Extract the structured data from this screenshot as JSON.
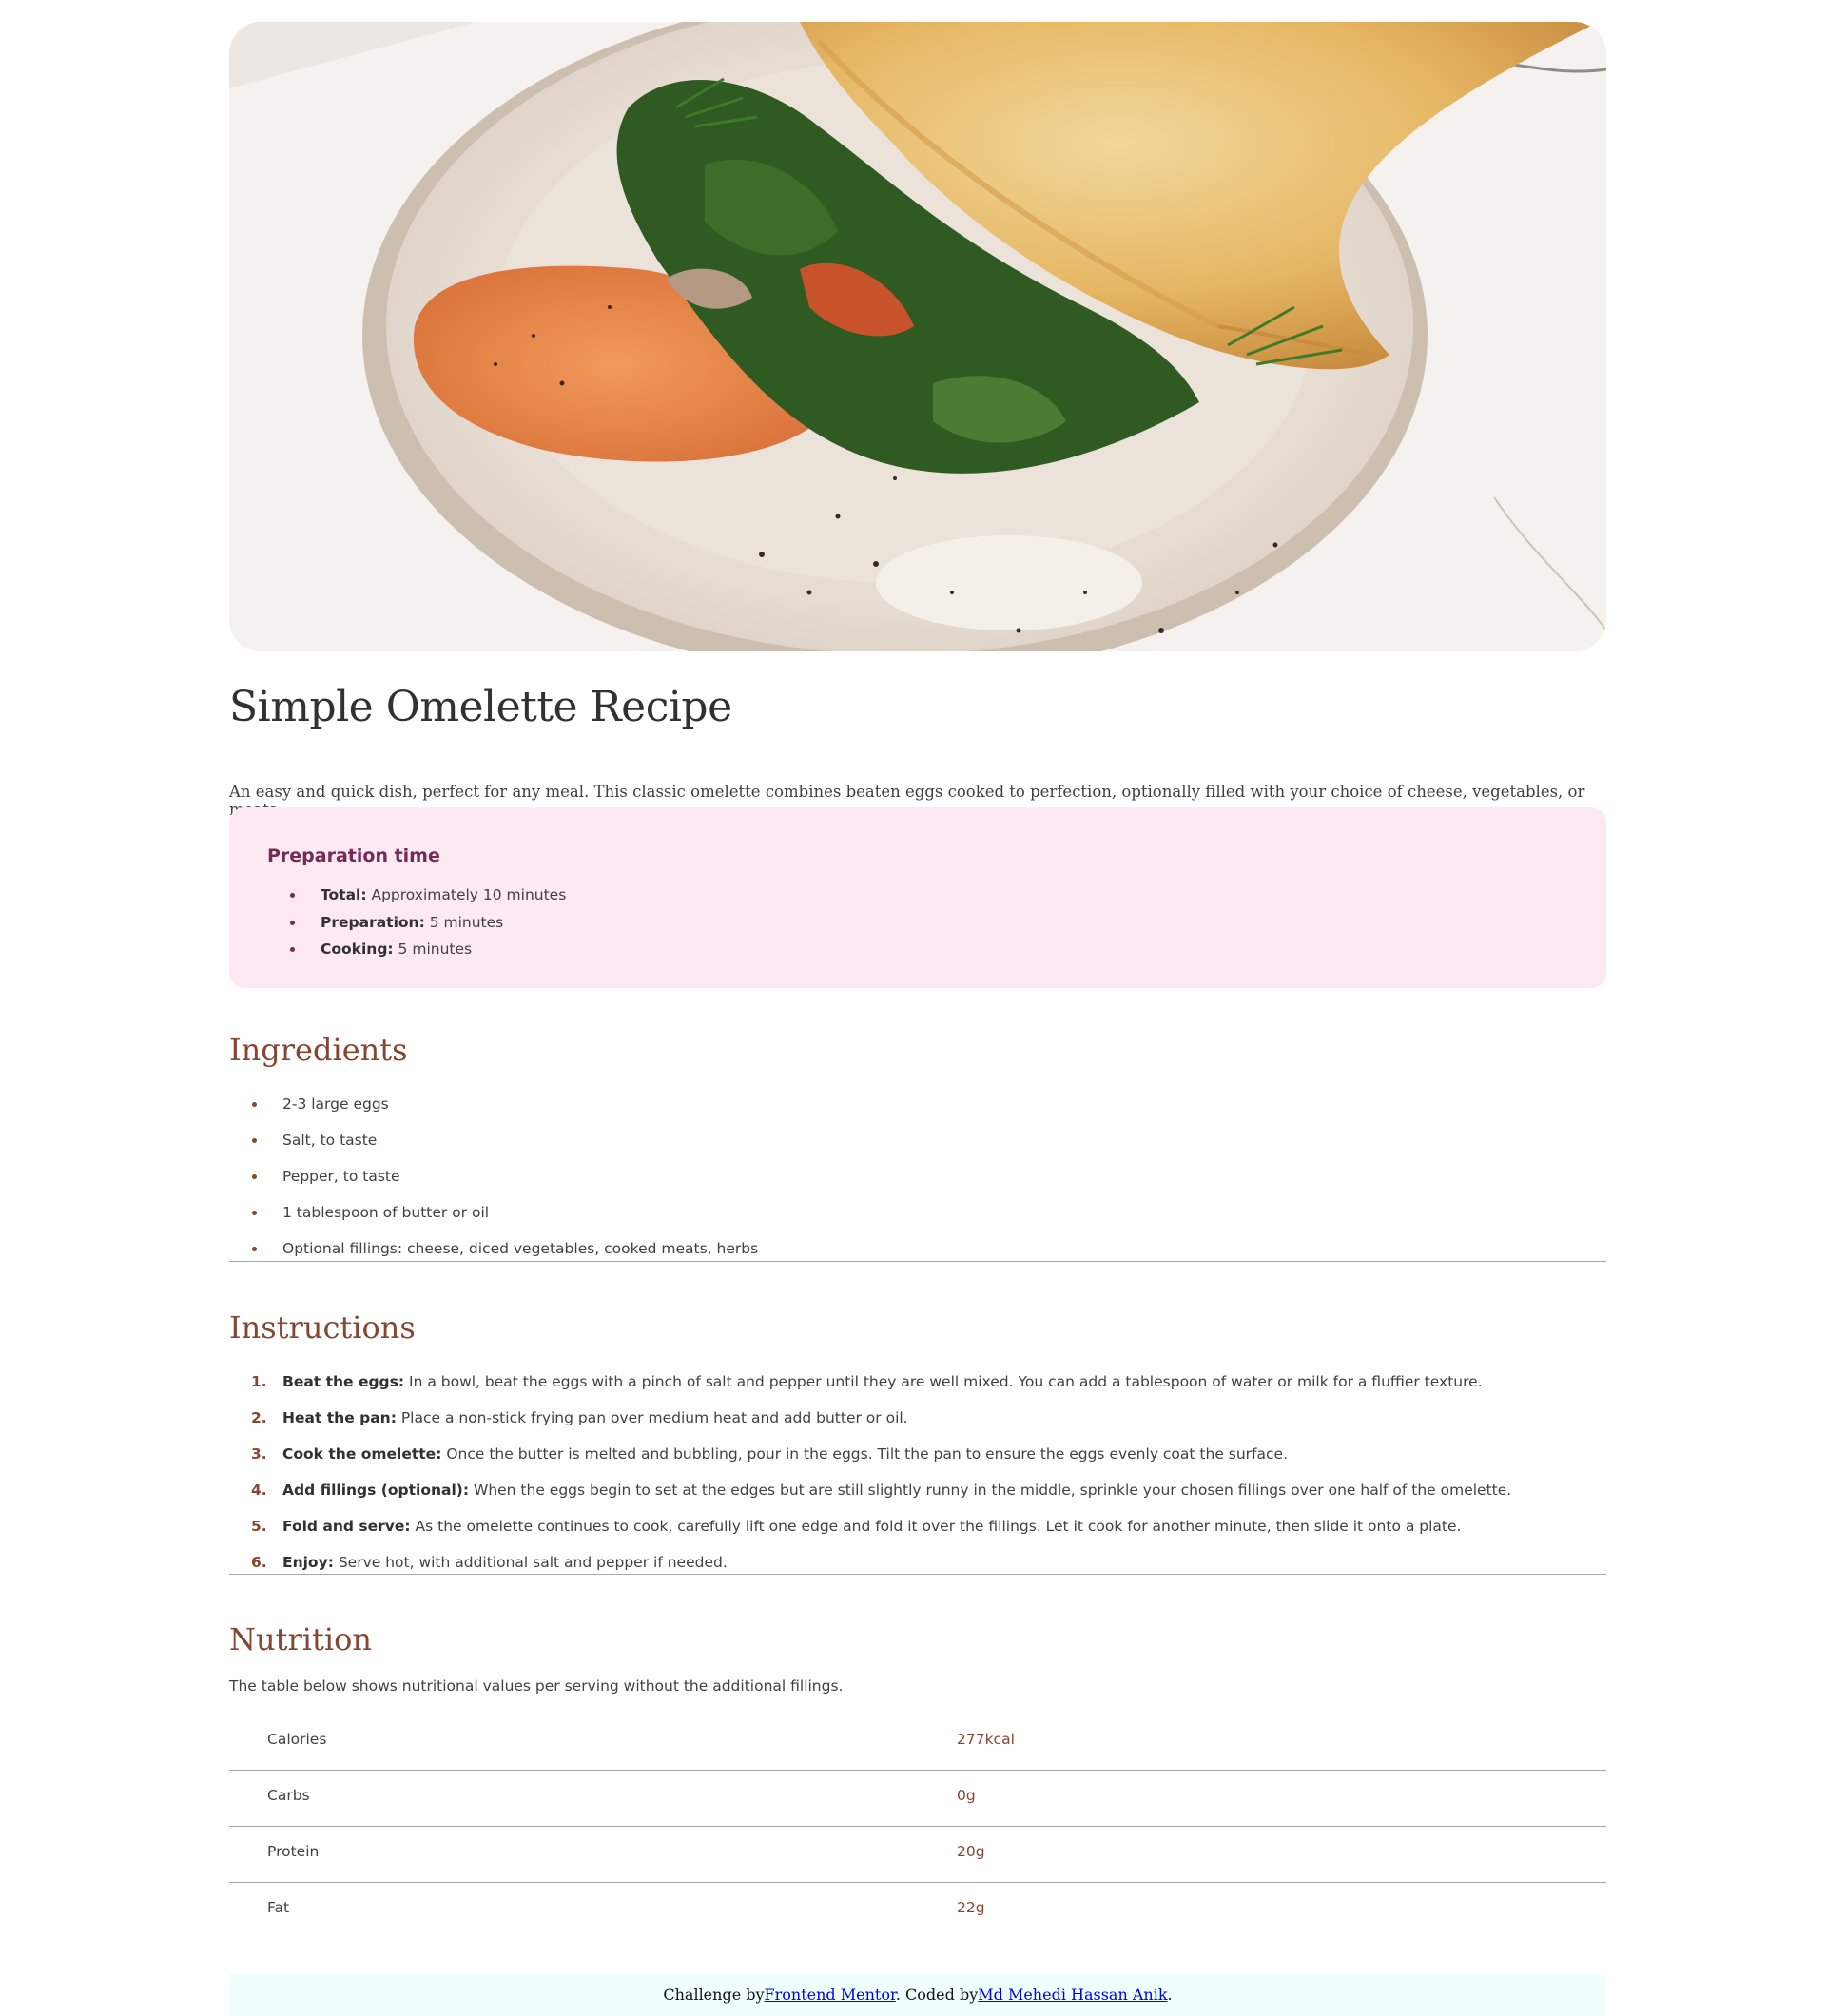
{
  "hero": {
    "alt": "Omelette on a plate"
  },
  "title": "Simple Omelette Recipe",
  "intro": "An easy and quick dish, perfect for any meal. This classic omelette combines beaten eggs cooked to perfection, optionally filled with your choice of cheese, vegetables, or meats.",
  "prep": {
    "heading": "Preparation time",
    "items": [
      {
        "label": "Total:",
        "text": " Approximately 10 minutes"
      },
      {
        "label": "Preparation:",
        "text": " 5 minutes"
      },
      {
        "label": "Cooking:",
        "text": " 5 minutes"
      }
    ]
  },
  "ingredients": {
    "heading": "Ingredients",
    "items": [
      "2-3 large eggs",
      "Salt, to taste",
      "Pepper, to taste",
      "1 tablespoon of butter or oil",
      "Optional fillings: cheese, diced vegetables, cooked meats, herbs"
    ]
  },
  "instructions": {
    "heading": "Instructions",
    "items": [
      {
        "num": "1.",
        "label": "Beat the eggs:",
        "text": " In a bowl, beat the eggs with a pinch of salt and pepper until they are well mixed. You can add a tablespoon of water or milk for a fluffier texture."
      },
      {
        "num": "2.",
        "label": "Heat the pan:",
        "text": " Place a non-stick frying pan over medium heat and add butter or oil."
      },
      {
        "num": "3.",
        "label": "Cook the omelette:",
        "text": " Once the butter is melted and bubbling, pour in the eggs. Tilt the pan to ensure the eggs evenly coat the surface."
      },
      {
        "num": "4.",
        "label": "Add fillings (optional):",
        "text": " When the eggs begin to set at the edges but are still slightly runny in the middle, sprinkle your chosen fillings over one half of the omelette."
      },
      {
        "num": "5.",
        "label": "Fold and serve:",
        "text": " As the omelette continues to cook, carefully lift one edge and fold it over the fillings. Let it cook for another minute, then slide it onto a plate."
      },
      {
        "num": "6.",
        "label": "Enjoy:",
        "text": " Serve hot, with additional salt and pepper if needed."
      }
    ]
  },
  "nutrition": {
    "heading": "Nutrition",
    "intro": "The table below shows nutritional values per serving without the additional fillings.",
    "rows": [
      {
        "name": "Calories",
        "value": "277kcal"
      },
      {
        "name": "Carbs",
        "value": "0g"
      },
      {
        "name": "Protein",
        "value": "20g"
      },
      {
        "name": "Fat",
        "value": "22g"
      }
    ]
  },
  "footer": {
    "prefix": "Challenge by",
    "link1": "Frontend Mentor",
    "middle": ". Coded by",
    "link2": "Md Mehedi Hassan Anik",
    "suffix": "."
  },
  "colors": {
    "accent": "#854632",
    "prep_bg": "#fde9f4",
    "prep_heading": "#752a55",
    "footer_bg": "#effffe"
  }
}
